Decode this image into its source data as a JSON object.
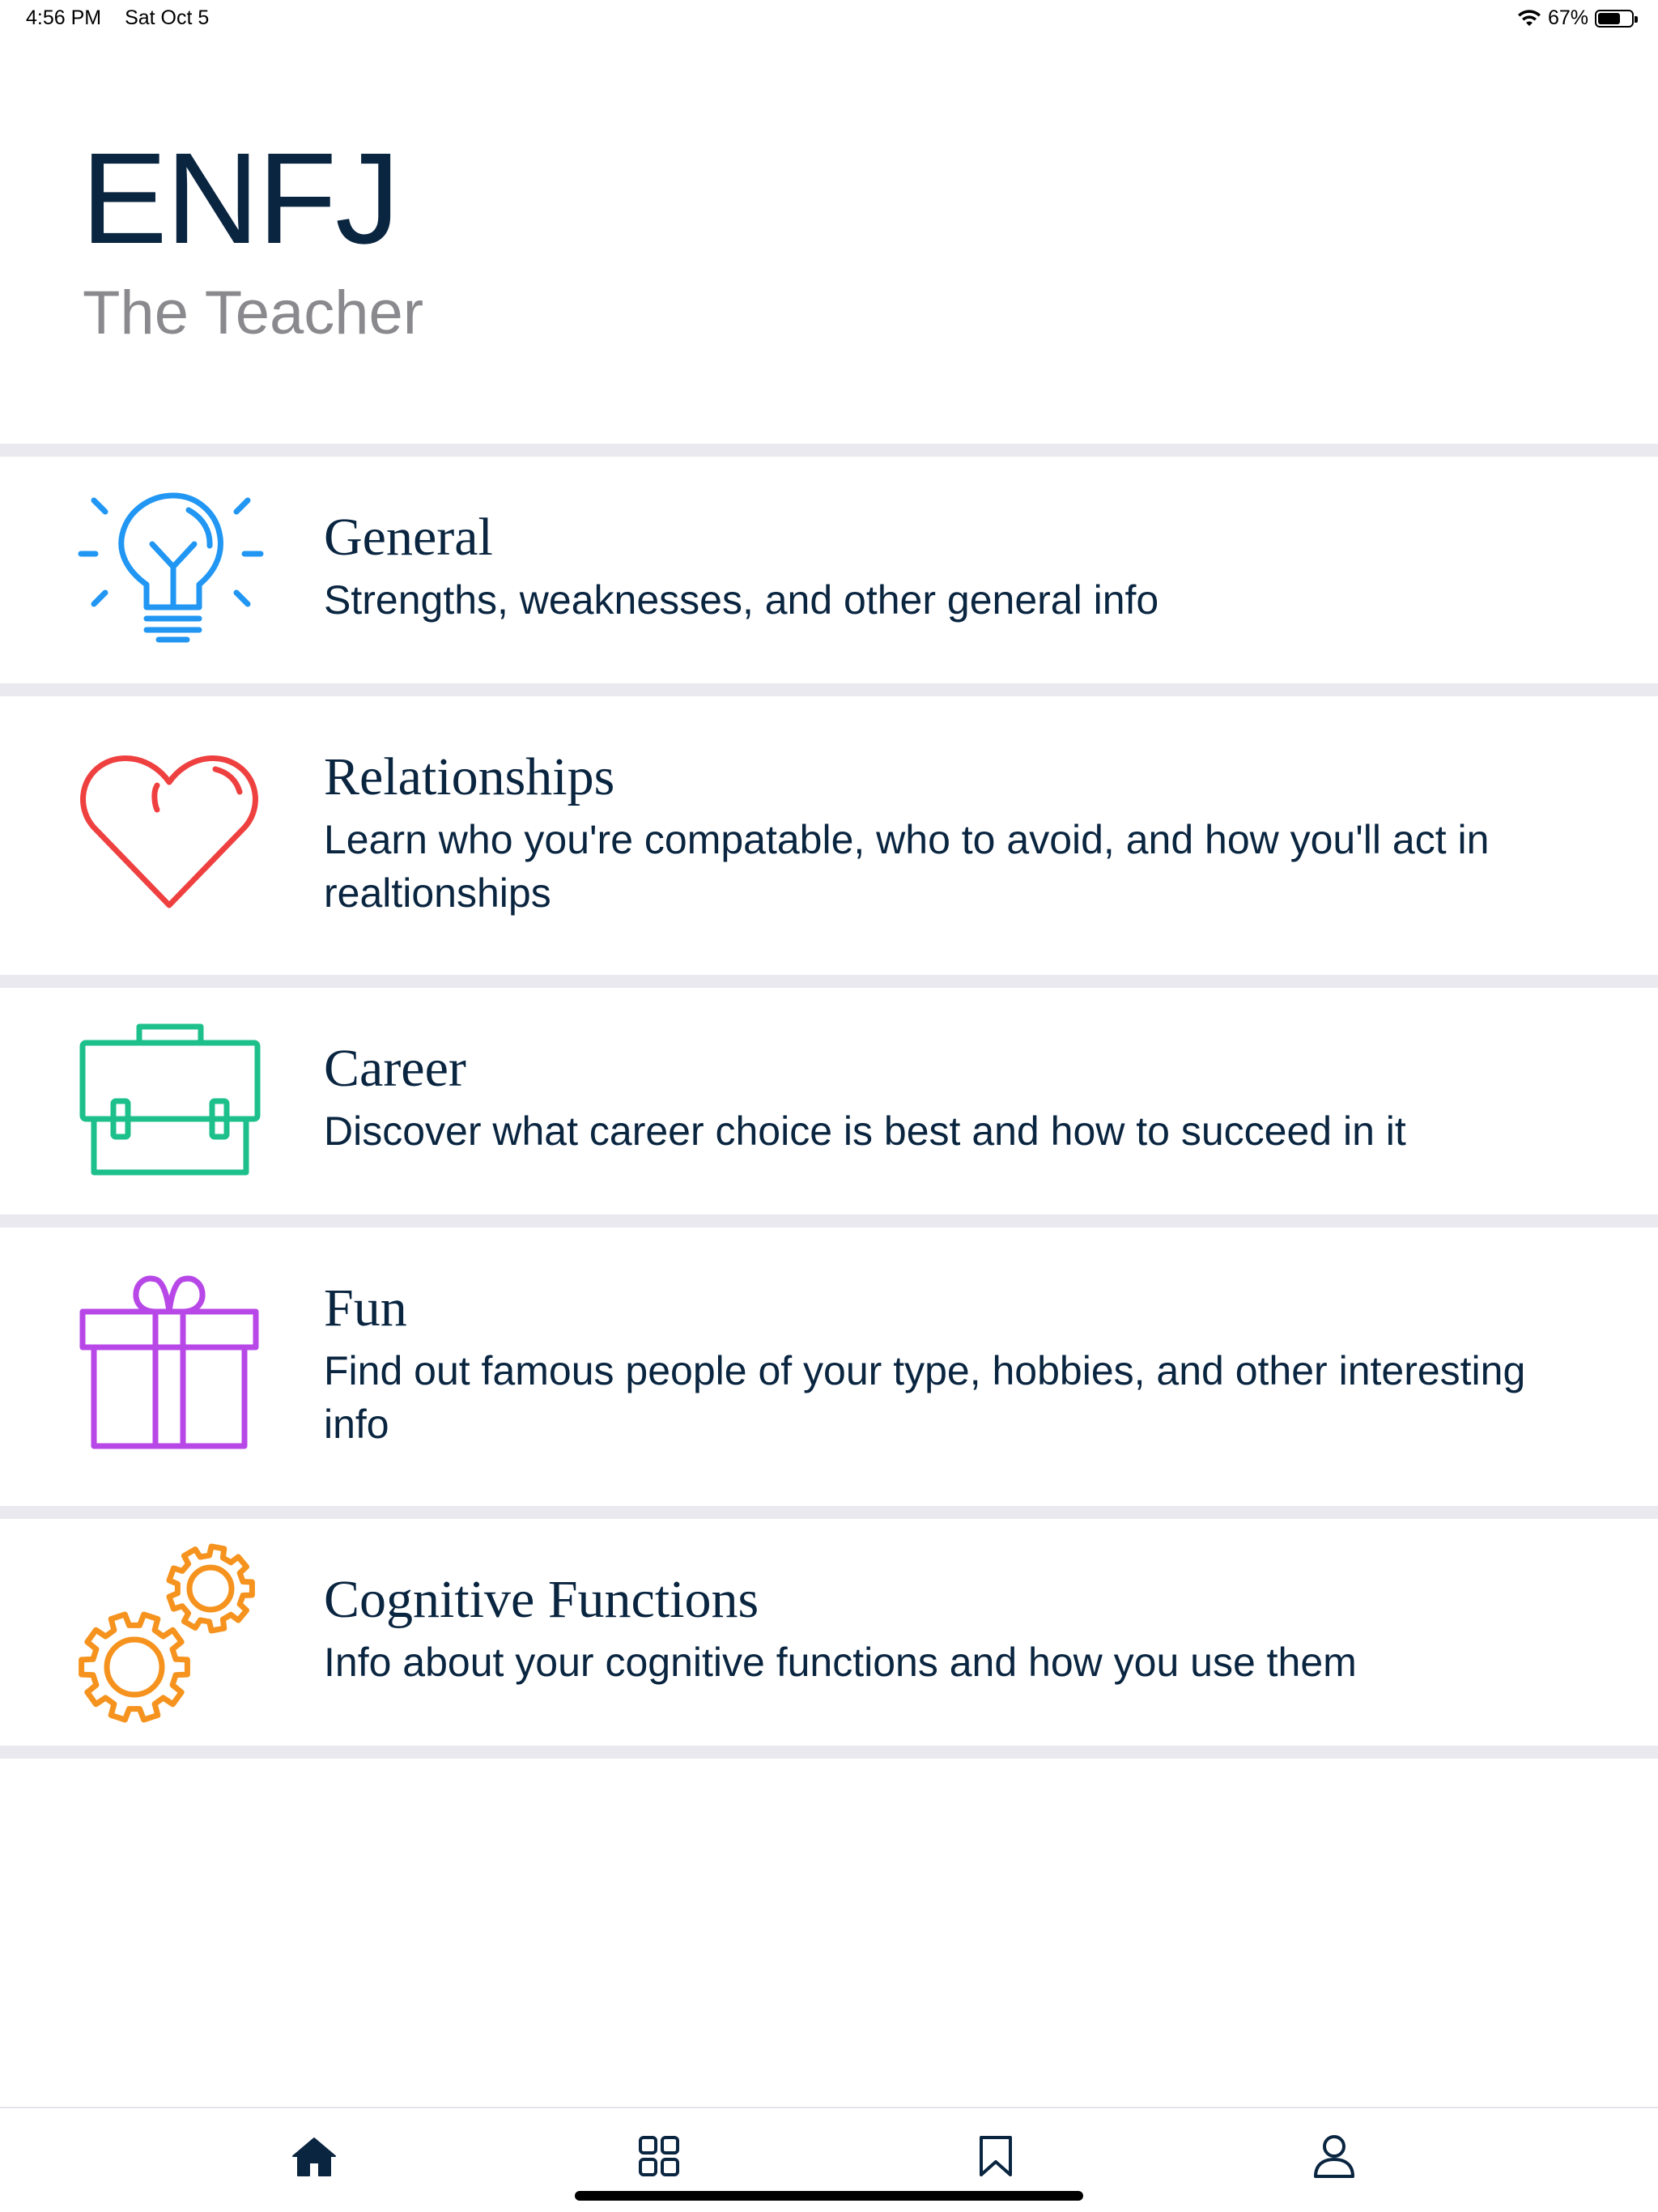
{
  "status_bar": {
    "time": "4:56 PM",
    "date": "Sat Oct 5",
    "battery_percent_text": "67%",
    "battery_level": 0.67
  },
  "header": {
    "type_code": "ENFJ",
    "type_name": "The Teacher"
  },
  "sections": [
    {
      "title": "General",
      "description": "Strengths, weaknesses, and other general info",
      "icon": "lightbulb-icon",
      "color": "#2196f3"
    },
    {
      "title": "Relationships",
      "description": "Learn who you're compatable, who to avoid, and how you'll act in realtionships",
      "icon": "heart-icon",
      "color": "#ef4040"
    },
    {
      "title": "Career",
      "description": "Discover what career choice is best and how to succeed in it",
      "icon": "briefcase-icon",
      "color": "#1dc08a"
    },
    {
      "title": "Fun",
      "description": "Find out famous people of your type, hobbies, and other interesting info",
      "icon": "gift-icon",
      "color": "#b847e8"
    },
    {
      "title": "Cognitive Functions",
      "description": "Info about your cognitive functions and how you use them",
      "icon": "gears-icon",
      "color": "#f5931e"
    }
  ],
  "tab_bar": {
    "tabs": [
      {
        "icon": "home-icon",
        "active": true
      },
      {
        "icon": "grid-icon",
        "active": false
      },
      {
        "icon": "bookmark-icon",
        "active": false
      },
      {
        "icon": "profile-icon",
        "active": false
      }
    ],
    "active_color": "#0a2540",
    "inactive_color": "#0a2540"
  }
}
